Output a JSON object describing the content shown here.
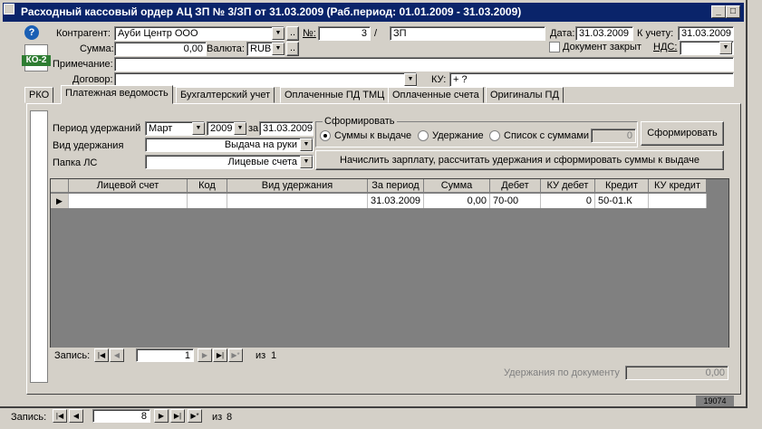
{
  "window": {
    "title": "Расходный кассовый ордер АЦ ЗП № 3/ЗП от 31.03.2009 (Раб.период: 01.01.2009 - 31.03.2009)",
    "btn_min": "_",
    "btn_max": "□",
    "btn_close": "×"
  },
  "header": {
    "kontragent_label": "Контрагент:",
    "kontragent_value": "Ауби Центр ООО",
    "summa_label": "Сумма:",
    "summa_value": "0,00",
    "valuta_label": "Валюта:",
    "valuta_value": "RUB",
    "primechanie_label": "Примечание:",
    "primechanie_value": "",
    "dogovor_label": "Договор:",
    "dogovor_value": "",
    "nomer_label": "№:",
    "nomer_value": "3",
    "nomer_sep": "/",
    "nomer_suffix": "ЗП",
    "data_label": "Дата:",
    "data_value": "31.03.2009",
    "k_uchetu_label": "К учету:",
    "k_uchetu_value": "31.03.2009",
    "doc_zakryt_label": "Документ закрыт",
    "nds_label": "НДС:",
    "nds_value": "",
    "ku_label": "КУ:",
    "ku_value": "+ ?",
    "ellipsis": "..",
    "ko_badge": "КО-2"
  },
  "tabs": [
    {
      "label": "РКО",
      "active": false
    },
    {
      "label": "Платежная ведомость",
      "active": true
    },
    {
      "label": "Бухгалтерский учет",
      "active": false
    },
    {
      "label": "Оплаченные ПД ТМЦ",
      "active": false
    },
    {
      "label": "Оплаченные счета",
      "active": false
    },
    {
      "label": "Оригиналы ПД",
      "active": false
    }
  ],
  "form": {
    "period_label": "Период удержаний",
    "period_month": "Март",
    "period_year": "2009",
    "za_label": "за",
    "za_value": "31.03.2009",
    "vid_label": "Вид удержания",
    "vid_value": "Выдача на руки",
    "papka_label": "Папка ЛС",
    "papka_value": "Лицевые счета",
    "sformirovat_group": "Сформировать",
    "radio1": "Суммы к выдаче",
    "radio2": "Удержание",
    "radio3": "Список с суммами",
    "spisok_value": "0",
    "sformirovat_btn": "Сформировать",
    "nachislit_btn": "Начислить зарплату, рассчитать удержания и сформировать суммы к выдаче"
  },
  "grid": {
    "columns": [
      "Лицевой счет",
      "Код",
      "Вид удержания",
      "За период",
      "Сумма",
      "Дебет",
      "КУ дебет",
      "Кредит",
      "КУ кредит"
    ],
    "rows": [
      [
        "",
        "",
        "",
        "31.03.2009",
        "0,00",
        "70-00",
        "0",
        "50-01.К",
        ""
      ]
    ]
  },
  "inner_nav": {
    "label": "Запись:",
    "current": "1",
    "of_label": "из",
    "total": "1"
  },
  "footer": {
    "uderzhaniya_label": "Удержания по документу",
    "uderzhaniya_value": "0,00",
    "doc_id": "19074"
  },
  "outer_nav": {
    "label": "Запись:",
    "current": "8",
    "of_label": "из",
    "total": "8"
  }
}
